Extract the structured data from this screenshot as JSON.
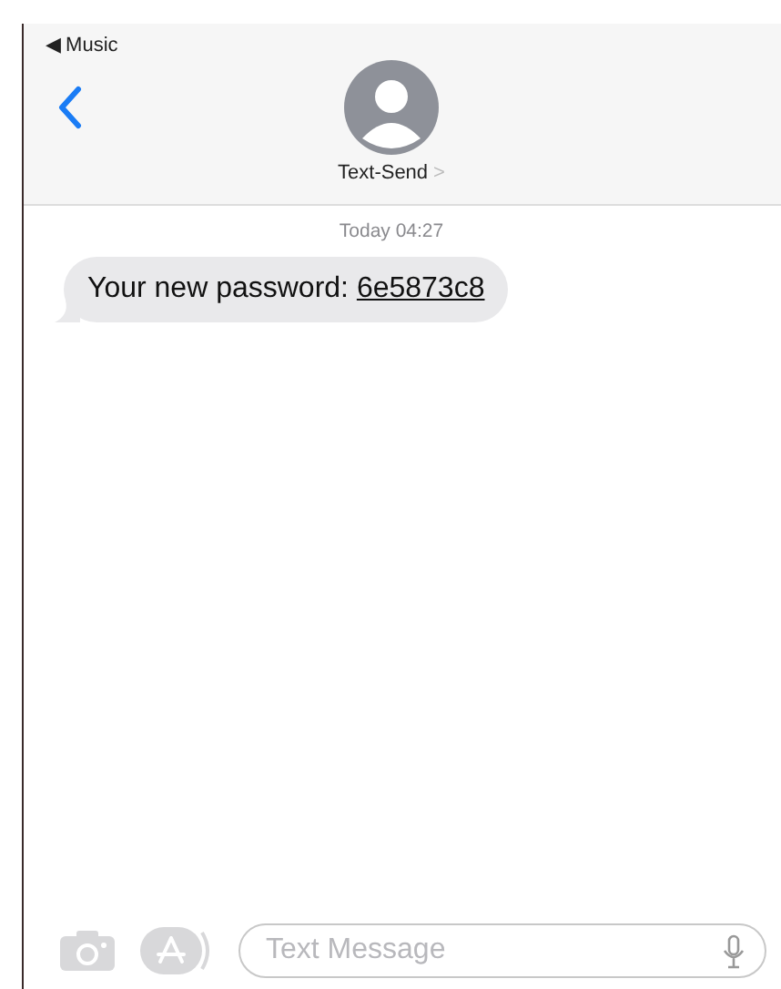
{
  "status_bar": {
    "back_app": "◀ Music"
  },
  "header": {
    "contact": "Text-Send",
    "chevron": ">"
  },
  "thread": {
    "timestamp": "Today 04:27",
    "messages": [
      {
        "kind": "incoming",
        "text": "Your new password: ",
        "link": "6e5873c8"
      }
    ]
  },
  "composer": {
    "placeholder": "Text Message"
  }
}
